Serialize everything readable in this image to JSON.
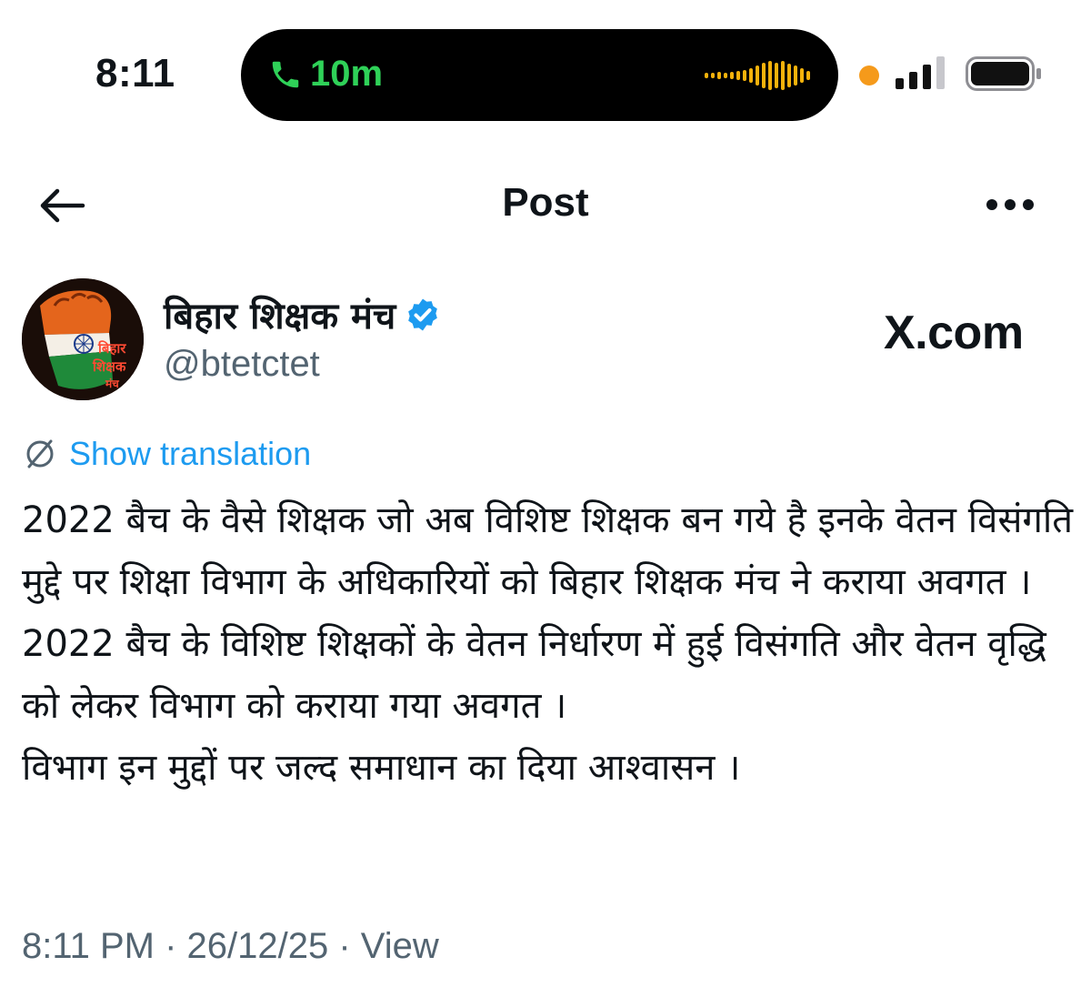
{
  "status_bar": {
    "time": "8:11",
    "call_duration": "10m",
    "colors": {
      "call_green": "#2fd158",
      "waveform_orange": "#f5b20b",
      "recording_dot": "#f59a1b"
    }
  },
  "header": {
    "title": "Post",
    "back_icon": "arrow-left-icon",
    "more_icon": "more-horizontal-icon"
  },
  "author": {
    "name": "बिहार शिक्षक मंच",
    "handle": "@btetctet",
    "verified": true,
    "avatar_text": [
      "बिहार",
      "शिक्षक",
      "मंच"
    ]
  },
  "watermark": "X.com",
  "translation": {
    "label": "Show translation",
    "icon": "translate-icon"
  },
  "post": {
    "paragraphs": [
      "2022 बैच के वैसे शिक्षक जो अब विशिष्ट शिक्षक बन गये है इनके वेतन विसंगति मुद्दे पर शिक्षा विभाग के अधिकारियों को बिहार शिक्षक मंच ने कराया अवगत ।",
      "2022 बैच के विशिष्ट शिक्षकों के वेतन निर्धारण में हुई विसंगति और वेतन वृद्धि को लेकर विभाग को कराया गया अवगत ।",
      "विभाग इन मुद्दों पर जल्द समाधान का दिया आश्वासन ।"
    ]
  },
  "meta": {
    "text": "8:11 PM · 26/12/25 · View"
  },
  "colors": {
    "link_blue": "#1d9bf0",
    "secondary_text": "#536471",
    "primary_text": "#0f1419"
  }
}
